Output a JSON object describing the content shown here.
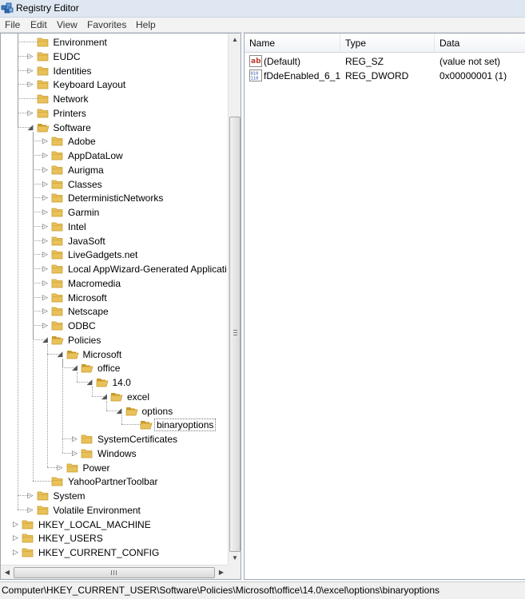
{
  "window": {
    "title": "Registry Editor"
  },
  "menu": [
    {
      "label": "File"
    },
    {
      "label": "Edit"
    },
    {
      "label": "View"
    },
    {
      "label": "Favorites"
    },
    {
      "label": "Help"
    }
  ],
  "tree": [
    {
      "label": "Environment",
      "level": 1,
      "expander": "none"
    },
    {
      "label": "EUDC",
      "level": 1,
      "expander": "collapsed"
    },
    {
      "label": "Identities",
      "level": 1,
      "expander": "collapsed"
    },
    {
      "label": "Keyboard Layout",
      "level": 1,
      "expander": "collapsed"
    },
    {
      "label": "Network",
      "level": 1,
      "expander": "none"
    },
    {
      "label": "Printers",
      "level": 1,
      "expander": "collapsed"
    },
    {
      "label": "Software",
      "level": 1,
      "expander": "expanded"
    },
    {
      "label": "Adobe",
      "level": 2,
      "expander": "collapsed"
    },
    {
      "label": "AppDataLow",
      "level": 2,
      "expander": "collapsed"
    },
    {
      "label": "Aurigma",
      "level": 2,
      "expander": "collapsed"
    },
    {
      "label": "Classes",
      "level": 2,
      "expander": "collapsed"
    },
    {
      "label": "DeterministicNetworks",
      "level": 2,
      "expander": "collapsed"
    },
    {
      "label": "Garmin",
      "level": 2,
      "expander": "collapsed"
    },
    {
      "label": "Intel",
      "level": 2,
      "expander": "collapsed"
    },
    {
      "label": "JavaSoft",
      "level": 2,
      "expander": "collapsed"
    },
    {
      "label": "LiveGadgets.net",
      "level": 2,
      "expander": "collapsed"
    },
    {
      "label": "Local AppWizard-Generated Applicatio",
      "level": 2,
      "expander": "collapsed"
    },
    {
      "label": "Macromedia",
      "level": 2,
      "expander": "collapsed"
    },
    {
      "label": "Microsoft",
      "level": 2,
      "expander": "collapsed"
    },
    {
      "label": "Netscape",
      "level": 2,
      "expander": "collapsed"
    },
    {
      "label": "ODBC",
      "level": 2,
      "expander": "collapsed"
    },
    {
      "label": "Policies",
      "level": 2,
      "expander": "expanded"
    },
    {
      "label": "Microsoft",
      "level": 3,
      "expander": "expanded"
    },
    {
      "label": "office",
      "level": 4,
      "expander": "expanded"
    },
    {
      "label": "14.0",
      "level": 5,
      "expander": "expanded"
    },
    {
      "label": "excel",
      "level": 6,
      "expander": "expanded"
    },
    {
      "label": "options",
      "level": 7,
      "expander": "expanded"
    },
    {
      "label": "binaryoptions",
      "level": 8,
      "expander": "none",
      "selected": true
    },
    {
      "label": "SystemCertificates",
      "level": 4,
      "expander": "collapsed"
    },
    {
      "label": "Windows",
      "level": 4,
      "expander": "collapsed"
    },
    {
      "label": "Power",
      "level": 3,
      "expander": "collapsed"
    },
    {
      "label": "YahooPartnerToolbar",
      "level": 2,
      "expander": "none"
    },
    {
      "label": "System",
      "level": 1,
      "expander": "collapsed"
    },
    {
      "label": "Volatile Environment",
      "level": 1,
      "expander": "collapsed"
    },
    {
      "label": "HKEY_LOCAL_MACHINE",
      "level": 0,
      "expander": "collapsed"
    },
    {
      "label": "HKEY_USERS",
      "level": 0,
      "expander": "collapsed"
    },
    {
      "label": "HKEY_CURRENT_CONFIG",
      "level": 0,
      "expander": "collapsed"
    }
  ],
  "list": {
    "columns": [
      {
        "label": "Name"
      },
      {
        "label": "Type"
      },
      {
        "label": "Data"
      }
    ],
    "rows": [
      {
        "icon": "string-value-icon",
        "name": "(Default)",
        "type": "REG_SZ",
        "data": "(value not set)"
      },
      {
        "icon": "dword-value-icon",
        "name": "fDdeEnabled_6_1",
        "type": "REG_DWORD",
        "data": "0x00000001 (1)"
      }
    ]
  },
  "status": {
    "path": "Computer\\HKEY_CURRENT_USER\\Software\\Policies\\Microsoft\\office\\14.0\\excel\\options\\binaryoptions"
  },
  "colors": {
    "folder": "#e8c15a",
    "folder_dark": "#c89a2a",
    "selection_border": "#777777",
    "title_bg": "#dfe8f2"
  }
}
